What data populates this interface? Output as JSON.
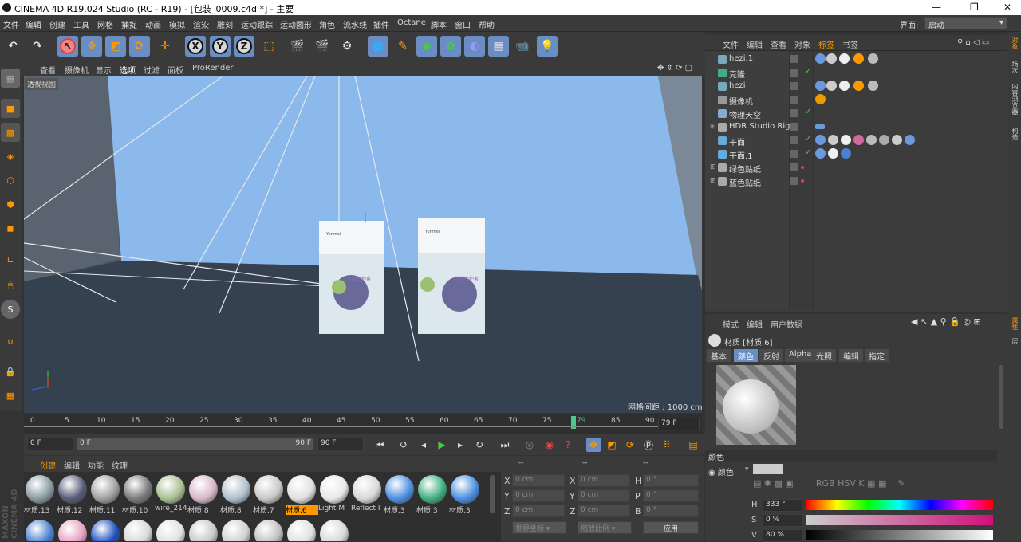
{
  "titlebar": {
    "title": "CINEMA 4D R19.024 Studio (RC - R19) - [包装_0009.c4d *] - 主要"
  },
  "menu": [
    "文件",
    "编辑",
    "创建",
    "工具",
    "网格",
    "捕捉",
    "动画",
    "模拟",
    "渲染",
    "雕刻",
    "运动跟踪",
    "运动图形",
    "角色",
    "流水线",
    "插件",
    "Octane",
    "脚本",
    "窗口",
    "帮助"
  ],
  "layout": {
    "label": "界面:",
    "value": "启动"
  },
  "viewport_menu": [
    "查看",
    "摄像机",
    "显示",
    "选项",
    "过滤",
    "面板",
    "ProRender"
  ],
  "viewport": {
    "label": "透视视图",
    "grid_distance": "网格间距 : 1000 cm"
  },
  "timeline": {
    "ticks": [
      "0",
      "5",
      "10",
      "15",
      "20",
      "25",
      "30",
      "35",
      "40",
      "45",
      "50",
      "55",
      "60",
      "65",
      "70",
      "75",
      "79",
      "80",
      "85",
      "90"
    ],
    "current": "79",
    "end_field": "79 F"
  },
  "playbar": {
    "start": "0 F",
    "range_start": "0 F",
    "range_end": "90 F",
    "end": "90 F"
  },
  "materials_menu": [
    "创建",
    "编辑",
    "功能",
    "纹理"
  ],
  "materials": [
    {
      "name": "材质.13",
      "color": "#8a9ba0"
    },
    {
      "name": "材质.12",
      "color": "#5a5a7a"
    },
    {
      "name": "材质.11",
      "color": "#a0a0a0"
    },
    {
      "name": "材质.10",
      "color": "#7a7a7a"
    },
    {
      "name": "wire_214",
      "color": "#a8c090"
    },
    {
      "name": "材质.8",
      "color": "#d8b8c8"
    },
    {
      "name": "材质.8",
      "color": "#b0c0cc"
    },
    {
      "name": "材质.7",
      "color": "#c8c8c8"
    },
    {
      "name": "材质.6",
      "color": "#e0e0e0"
    },
    {
      "name": "Light M",
      "color": "#e8e8e8"
    },
    {
      "name": "Reflect I",
      "color": "#d8d8d8"
    },
    {
      "name": "材质.3",
      "color": "#4a90e0"
    },
    {
      "name": "材质.3",
      "color": "#40b080"
    },
    {
      "name": "材质.3",
      "color": "#4a90e0"
    }
  ],
  "materials_row2_colors": [
    "#4a80d0",
    "#e8a0c0",
    "#2050c0",
    "#d8d8d8",
    "#e0e0e0",
    "#c8c8c8",
    "#d0d0d0",
    "#c0c0c0",
    "#e0e0e0",
    "#d8d8d8"
  ],
  "coords": {
    "headers": [
      "--",
      "--",
      "--"
    ],
    "rows": [
      [
        "X",
        "0 cm",
        "X",
        "0 cm",
        "H",
        "0 °"
      ],
      [
        "Y",
        "0 cm",
        "Y",
        "0 cm",
        "P",
        "0 °"
      ],
      [
        "Z",
        "0 cm",
        "Z",
        "0 cm",
        "B",
        "0 °"
      ]
    ],
    "world": "世界坐标",
    "scale": "缩放比例",
    "apply": "应用"
  },
  "object_menu": [
    "文件",
    "编辑",
    "查看",
    "对象",
    "标签",
    "书签"
  ],
  "objects": [
    {
      "name": "hezi.1",
      "icon": "#7ab"
    },
    {
      "name": "克隆",
      "icon": "#4a8"
    },
    {
      "name": "hezi",
      "icon": "#7ab"
    },
    {
      "name": "摄像机",
      "icon": "#999"
    },
    {
      "name": "物理天空",
      "icon": "#8ac"
    },
    {
      "name": "HDR Studio Rig",
      "icon": "#aaa"
    },
    {
      "name": "平面",
      "icon": "#6ad"
    },
    {
      "name": "平面.1",
      "icon": "#6ad"
    },
    {
      "name": "绿色贴纸",
      "icon": "#aaa"
    },
    {
      "name": "蓝色贴纸",
      "icon": "#aaa"
    }
  ],
  "attr_menu": [
    "模式",
    "编辑",
    "用户数据"
  ],
  "attr": {
    "title": "材质 [材质.6]",
    "tabs": [
      "基本",
      "颜色",
      "反射",
      "Alpha",
      "光照",
      "编辑",
      "指定"
    ],
    "section": "颜色",
    "color_label": "颜色",
    "h_label": "H",
    "h_value": "333 °",
    "s_label": "S",
    "s_value": "0 %",
    "v_label": "V",
    "v_value": "80 %"
  },
  "right_rail": [
    "对象",
    "场次",
    "内容浏览器",
    "构造",
    "属性",
    "层"
  ],
  "package": {
    "brand": "Yunmei",
    "front_text": "蓝莓保护素"
  }
}
